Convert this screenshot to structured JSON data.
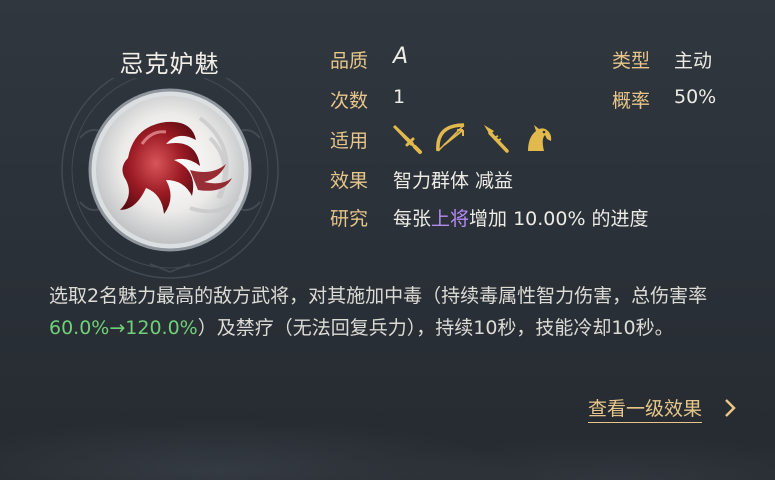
{
  "skill": {
    "name": "忌克妒魅",
    "quality_label": "品质",
    "quality": "A",
    "type_label": "类型",
    "type": "主动",
    "count_label": "次数",
    "count": "1",
    "rate_label": "概率",
    "rate": "50%",
    "applicable_label": "适用",
    "applicable_icons": [
      "sword-icon",
      "bow-icon",
      "spear-icon",
      "horse-icon"
    ],
    "effect_label": "效果",
    "effect": "智力群体 减益",
    "research_label": "研究",
    "research": {
      "prefix": "每张",
      "highlight": "上将",
      "suffix": "增加 10.00% 的进度",
      "highlight_color": "#b48cf0"
    }
  },
  "description": {
    "part1": "选取2名魅力最高的敌方武将，对其施加中毒（持续毒属性智力伤害，总伤害率",
    "highlight": "60.0%→120.0%",
    "part2": "）及禁疗（无法回复兵力），持续10秒，技能冷却10秒。",
    "highlight_color": "#6fd07a"
  },
  "link_label": "查看一级效果",
  "colors": {
    "label": "#e6c68a",
    "text": "#ecebe6",
    "background": "#2c3239"
  }
}
